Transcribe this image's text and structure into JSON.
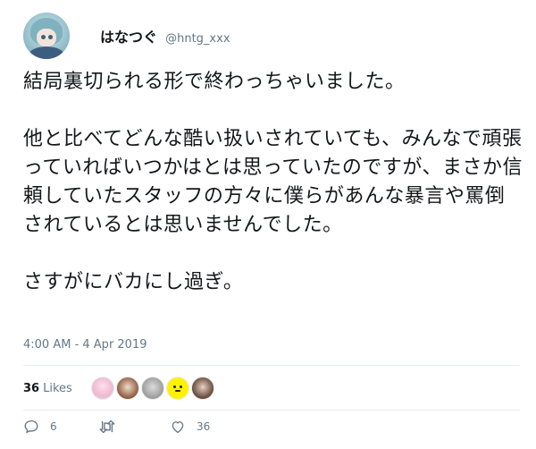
{
  "user": {
    "display_name": "はなつぐ",
    "handle": "@hntg_xxx"
  },
  "tweet": {
    "paragraphs": [
      "結局裏切られる形で終わっちゃいました。",
      "他と比べてどんな酷い扱いされていても、みんなで頑張っていればいつかはとは思っていたのですが、まさか信頼していたスタッフの方々に僕らがあんな暴言や罵倒されているとは思いませんでした。",
      "さすがにバカにし過ぎ。"
    ],
    "timestamp": "4:00 AM - 4 Apr 2019"
  },
  "likes": {
    "count": "36",
    "label": "Likes"
  },
  "actions": {
    "reply_count": "6",
    "retweet_count": "",
    "like_count": "36"
  },
  "icons": {
    "reply": "reply-icon",
    "retweet": "retweet-icon",
    "like": "heart-icon"
  },
  "colors": {
    "text": "#14171a",
    "muted": "#657786",
    "divider": "#e6ecf0"
  }
}
